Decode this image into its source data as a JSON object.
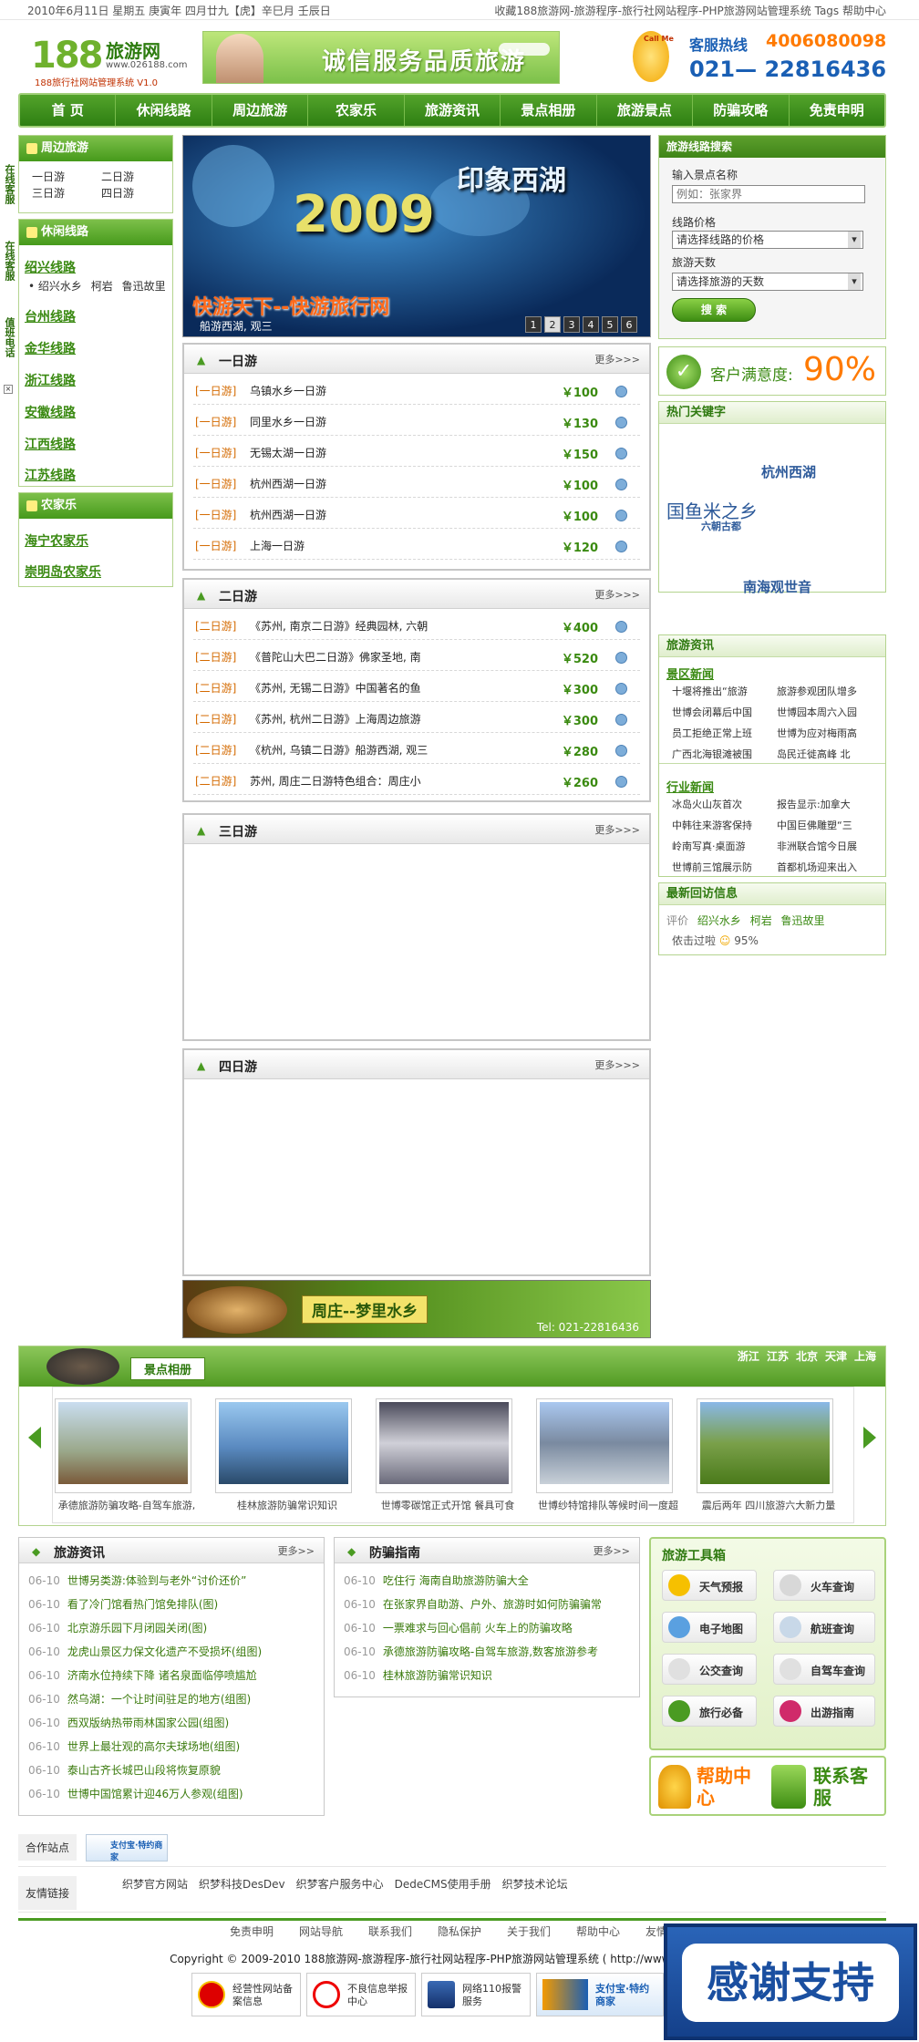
{
  "topbar": {
    "date": "2010年6月11日 星期五 庚寅年 四月廿九【虎】辛巳月 壬辰日",
    "right": "收藏188旅游网-旅游程序-旅行社网站程序-PHP旅游网站管理系统 Tags 帮助中心"
  },
  "logo": {
    "brand": "188",
    "name": "旅游网",
    "url": "www.026188.com",
    "slogan": "188旅行社网站管理系统 V1.0"
  },
  "banner": {
    "text": "诚信服务品质旅游"
  },
  "hotline": {
    "label": "客服热线",
    "phone1": "4006080098",
    "phone2": "021— 22816436",
    "callme": "Call Me"
  },
  "nav": [
    "首 页",
    "休闲线路",
    "周边旅游",
    "农家乐",
    "旅游资讯",
    "景点相册",
    "旅游景点",
    "防骗攻略",
    "免责申明"
  ],
  "left": {
    "nearby": {
      "title": "周边旅游",
      "items": [
        "一日游",
        "二日游",
        "三日游",
        "四日游"
      ]
    },
    "leisure": {
      "title": "休闲线路",
      "first": "绍兴线路",
      "sub": [
        "绍兴水乡",
        "柯岩",
        "鲁迅故里"
      ],
      "routes": [
        "台州线路",
        "金华线路",
        "浙江线路",
        "安徽线路",
        "江西线路",
        "江苏线路"
      ]
    },
    "farm": {
      "title": "农家乐",
      "items": [
        "海宁农家乐",
        "崇明岛农家乐"
      ]
    },
    "float_tabs": [
      "在线客服",
      "在线客服",
      "值班电话"
    ]
  },
  "slider": {
    "title": "印象西湖",
    "year": "2009",
    "slogan": "快游天下--快游旅行网",
    "caption": "船游西湖, 观三",
    "pages": [
      "1",
      "2",
      "3",
      "4",
      "5",
      "6"
    ],
    "active": "2"
  },
  "day1": {
    "title": "一日游",
    "more": "更多>>>",
    "rows": [
      {
        "tag": "[一日游]",
        "name": "乌镇水乡一日游",
        "price": "￥100"
      },
      {
        "tag": "[一日游]",
        "name": "同里水乡一日游",
        "price": "￥130"
      },
      {
        "tag": "[一日游]",
        "name": "无锡太湖一日游",
        "price": "￥150"
      },
      {
        "tag": "[一日游]",
        "name": "杭州西湖一日游",
        "price": "￥100"
      },
      {
        "tag": "[一日游]",
        "name": "杭州西湖一日游",
        "price": "￥100"
      },
      {
        "tag": "[一日游]",
        "name": "上海一日游",
        "price": "￥120"
      }
    ]
  },
  "day2": {
    "title": "二日游",
    "more": "更多>>>",
    "rows": [
      {
        "tag": "[二日游]",
        "name": "《苏州, 南京二日游》经典园林, 六朝",
        "price": "￥400"
      },
      {
        "tag": "[二日游]",
        "name": "《普陀山大巴二日游》佛家圣地, 南",
        "price": "￥520"
      },
      {
        "tag": "[二日游]",
        "name": "《苏州, 无锡二日游》中国著名的鱼",
        "price": "￥300"
      },
      {
        "tag": "[二日游]",
        "name": "《苏州, 杭州二日游》上海周边旅游",
        "price": "￥300"
      },
      {
        "tag": "[二日游]",
        "name": "《杭州, 乌镇二日游》船游西湖, 观三",
        "price": "￥280"
      },
      {
        "tag": "[二日游]",
        "name": "苏州, 周庄二日游特色组合：周庄小",
        "price": "￥260"
      }
    ]
  },
  "day3": {
    "title": "三日游",
    "more": "更多>>>"
  },
  "day4": {
    "title": "四日游",
    "more": "更多>>>"
  },
  "ad": {
    "text": "周庄--梦里水乡",
    "tel": "Tel: 021-22816436"
  },
  "search": {
    "title": "旅游线路搜索",
    "l1": "输入景点名称",
    "ph": "例如：张家界",
    "l2": "线路价格",
    "s1": "请选择线路的价格",
    "l3": "旅游天数",
    "s2": "请选择旅游的天数",
    "btn": "搜 索"
  },
  "satisfaction": {
    "label": "客户满意度:",
    "value": "90%"
  },
  "keywords": {
    "title": "热门关键字",
    "words": [
      "杭州西湖",
      "国鱼米之乡",
      "六朝古都",
      "南海观世音"
    ]
  },
  "news": {
    "title": "旅游资讯",
    "s1": "景区新闻",
    "s1items": [
      "十堰将推出“旅游",
      "旅游参观团队增多",
      "世博会闭幕后中国",
      "世博园本周六入园",
      "员工拒绝正常上班",
      "世博为应对梅雨高",
      "广西北海银滩被围",
      "岛民迁徙高峰 北"
    ],
    "s2": "行业新闻",
    "s2items": [
      "冰岛火山灰首次",
      "报告显示:加拿大",
      "中韩往来游客保持",
      "中国巨佛雕塑“三",
      "岭南写真·桌面游",
      "非洲联合馆今日展",
      "世博前三馆展示防",
      "首都机场迎来出入"
    ]
  },
  "reviews": {
    "title": "最新回访信息",
    "label": "评价",
    "links": [
      "绍兴水乡",
      "柯岩",
      "鲁迅故里"
    ],
    "user": "侬击过啦",
    "score": "95%"
  },
  "gallery": {
    "title": "景点相册",
    "cities": [
      "浙江",
      "江苏",
      "北京",
      "天津",
      "上海"
    ],
    "items": [
      "承德旅游防骗攻略-自驾车旅游,",
      "桂林旅游防骗常识知识",
      "世博零碳馆正式开馆 餐具可食",
      "世博纱特馆排队等候时间一度超",
      "震后两年 四川旅游六大新力量"
    ]
  },
  "newsA": {
    "title": "旅游资讯",
    "more": "更多>>",
    "items": [
      {
        "d": "06-10",
        "t": "世博另类游:体验到与老外“讨价还价”"
      },
      {
        "d": "06-10",
        "t": "看了冷门馆看热门馆免排队(图)"
      },
      {
        "d": "06-10",
        "t": "北京游乐园下月闭园关闭(图)"
      },
      {
        "d": "06-10",
        "t": "龙虎山景区力保文化遗产不受损坏(组图)"
      },
      {
        "d": "06-10",
        "t": "济南水位持续下降 诸名泉面临停喷尴尬"
      },
      {
        "d": "06-10",
        "t": "然乌湖：一个让时间驻足的地方(组图)"
      },
      {
        "d": "06-10",
        "t": "西双版纳热带雨林国家公园(组图)"
      },
      {
        "d": "06-10",
        "t": "世界上最壮观的高尔夫球场地(组图)"
      },
      {
        "d": "06-10",
        "t": "泰山古齐长城巴山段将恢复原貌"
      },
      {
        "d": "06-10",
        "t": "世博中国馆累计迎46万人参观(组图)"
      }
    ]
  },
  "newsB": {
    "title": "防骗指南",
    "more": "更多>>",
    "items": [
      {
        "d": "06-10",
        "t": "吃住行 海南自助旅游防骗大全"
      },
      {
        "d": "06-10",
        "t": "在张家界自助游、户外、旅游时如何防骗骗常"
      },
      {
        "d": "06-10",
        "t": "一票难求与回心倡前 火车上的防骗攻略"
      },
      {
        "d": "06-10",
        "t": "承德旅游防骗攻略-自驾车旅游,数客旅游参考"
      },
      {
        "d": "06-10",
        "t": "桂林旅游防骗常识知识"
      }
    ]
  },
  "tools": {
    "title": "旅游工具箱",
    "items": [
      "天气预报",
      "火车查询",
      "电子地图",
      "航班查询",
      "公交查询",
      "自驾车查询",
      "旅行必备",
      "出游指南"
    ],
    "help": "帮助中心",
    "contact": "联系客服"
  },
  "partners": {
    "label": "合作站点",
    "alipay": "支付宝·特约商家"
  },
  "friends": {
    "label": "友情链接",
    "links": [
      "织梦官方网站",
      "织梦科技DesDev",
      "织梦客户服务中心",
      "DedeCMS使用手册",
      "织梦技术论坛"
    ]
  },
  "footer": {
    "links": [
      "免责申明",
      "网站导航",
      "联系我们",
      "隐私保护",
      "关于我们",
      "帮助中心",
      "友情链接"
    ],
    "copyright": "Copyright © 2009-2010 188旅游网-旅游程序-旅行社网站程序-PHP旅游网站管理系统 ( http://www.026188.com )",
    "badges": [
      "经营性网站备案信息",
      "不良信息举报中心",
      "网络110报警服务",
      "支付宝·特约商家"
    ],
    "thanks": "感谢支持"
  },
  "colors": {
    "brand": "#4a9b22",
    "price": "#3a8a10",
    "orange": "#ff7a00",
    "tag": "#d46a00"
  }
}
